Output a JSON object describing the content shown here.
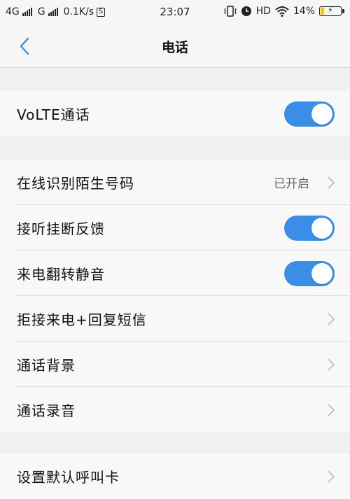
{
  "status_bar": {
    "net1": "4G",
    "net2": "G",
    "speed": "0.1K/s",
    "s_badge": "S",
    "time": "23:07",
    "hd": "HD",
    "battery": "14%",
    "icons": [
      "signal-bars-icon",
      "vibrate-icon",
      "alarm-icon",
      "wifi-icon",
      "battery-charging-icon"
    ]
  },
  "nav": {
    "title": "电话",
    "back_icon": "chevron-left-icon"
  },
  "sections": {
    "volte": {
      "label": "VoLTE通话",
      "toggle": "on"
    },
    "items": {
      "stranger_id": {
        "label": "在线识别陌生号码",
        "value": "已开启"
      },
      "answer_feedback": {
        "label": "接听挂断反馈",
        "toggle": "on"
      },
      "flip_mute": {
        "label": "来电翻转静音",
        "toggle": "on"
      },
      "reject_sms": {
        "label": "拒接来电+回复短信"
      },
      "call_background": {
        "label": "通话背景"
      },
      "call_recording": {
        "label": "通话录音"
      }
    },
    "default_card": {
      "label": "设置默认呼叫卡"
    }
  },
  "colors": {
    "accent": "#3a8ee6",
    "background": "#f0f0f0",
    "row_background": "#f8f8f8"
  }
}
